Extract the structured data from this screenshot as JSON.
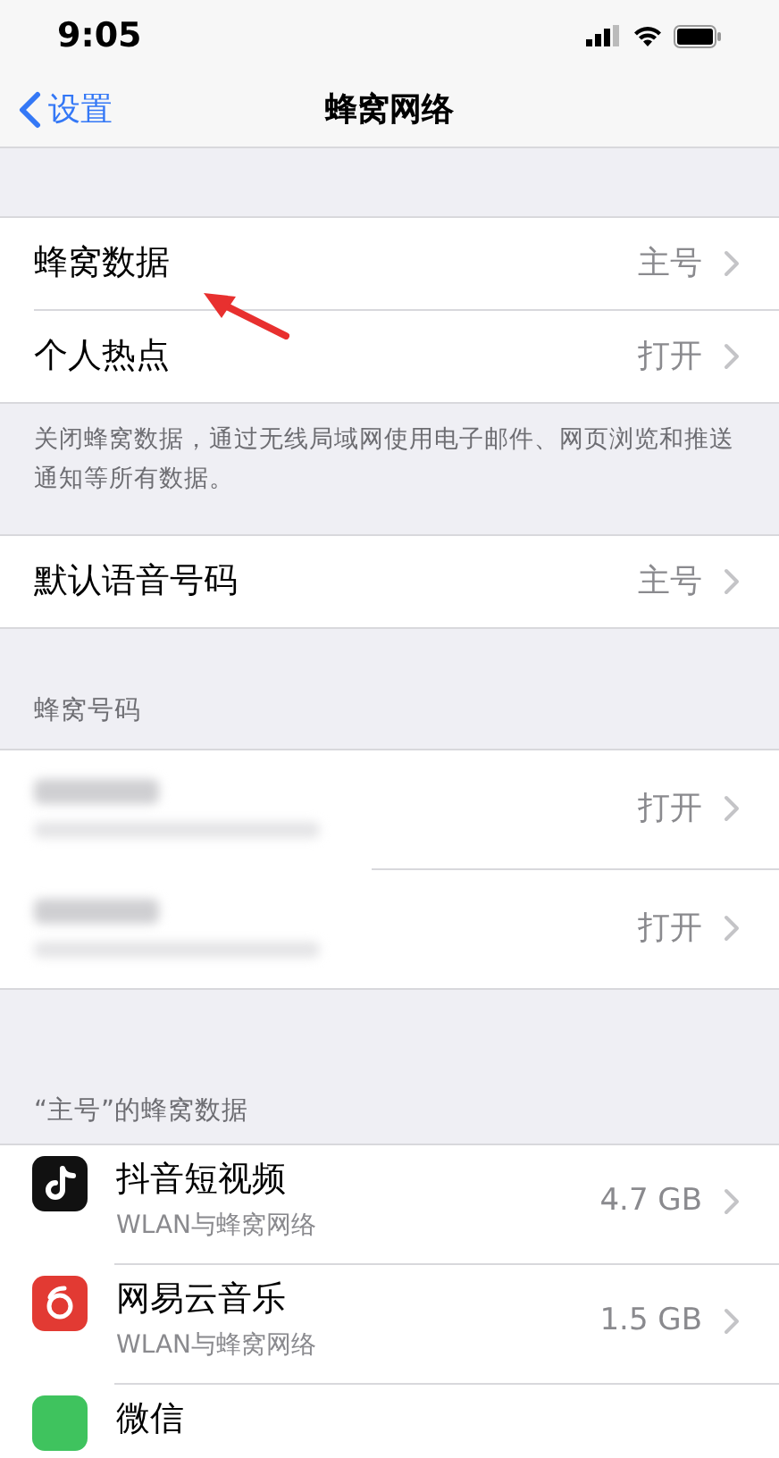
{
  "status_bar": {
    "time": "9:05"
  },
  "nav": {
    "back": "设置",
    "title": "蜂窝网络"
  },
  "group_1": [
    {
      "label": "蜂窝数据",
      "value": "主号"
    },
    {
      "label": "个人热点",
      "value": "打开"
    }
  ],
  "group_1_footer": "关闭蜂窝数据，通过无线局域网使用电子邮件、网页浏览和推送通知等所有数据。",
  "group_2": [
    {
      "label": "默认语音号码",
      "value": "主号"
    }
  ],
  "sim_header": "蜂窝号码",
  "sims": [
    {
      "value": "打开"
    },
    {
      "value": "打开"
    }
  ],
  "apps_header": "“主号”的蜂窝数据",
  "apps": [
    {
      "kind": "tiktok",
      "name": "抖音短视频",
      "subtitle": "WLAN与蜂窝网络",
      "usage": "4.7 GB"
    },
    {
      "kind": "netease",
      "name": "网易云音乐",
      "subtitle": "WLAN与蜂窝网络",
      "usage": "1.5 GB"
    },
    {
      "kind": "wechat",
      "name": "微信"
    }
  ]
}
